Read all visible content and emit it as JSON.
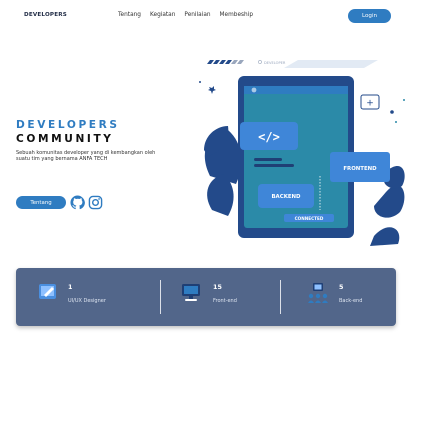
{
  "nav": {
    "brand": "DEVELOPERS",
    "links": [
      "Tentang",
      "Kegiatan",
      "Penilaian",
      "Membeship"
    ],
    "login_label": "Login"
  },
  "hero": {
    "title_line1": "DEVELOPERS",
    "title_line2": "COMMUNITY",
    "description": "Sebuah komunitas developer yang di kembangkan oleh suatu tim yang bernama ANFA TECH",
    "tag_label": "Tentang",
    "social": [
      "github-icon",
      "instagram-icon"
    ]
  },
  "illustration": {
    "small_label": "DEVELOPER",
    "code_symbol": "</>",
    "plus_symbol": "+",
    "frontend_label": "FRONTEND",
    "backend_label": "BACKEND",
    "connected_label": "CONNECTED"
  },
  "stats": [
    {
      "value": "1",
      "label": "UI/UX Designer",
      "icon": "design-tablet-icon"
    },
    {
      "value": "15",
      "label": "Front-end",
      "icon": "monitor-icon"
    },
    {
      "value": "5",
      "label": "Back-end",
      "icon": "server-team-icon"
    }
  ],
  "colors": {
    "accent": "#2f7cc1",
    "stats_bar": "#52668a",
    "illustration_green": "#234a8a",
    "screen_teal": "#2b8aa8"
  }
}
